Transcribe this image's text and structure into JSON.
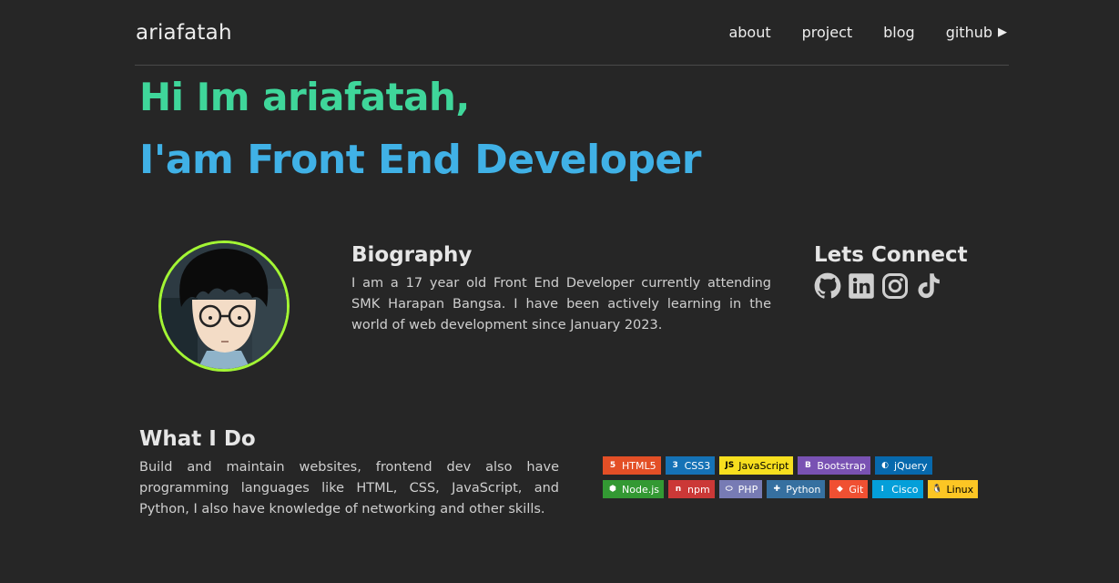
{
  "nav": {
    "brand": "ariafatah",
    "links": [
      "about",
      "project",
      "blog",
      "github"
    ],
    "github_arrow": "▶"
  },
  "hero": {
    "line1": "Hi Im ariafatah,",
    "line2": "I'am Front End Developer",
    "line1_color": "#3fd69a",
    "line2_color": "#40b1e6"
  },
  "biography": {
    "title": "Biography",
    "text": "I am a 17 year old Front End Developer currently attending SMK Harapan Bangsa. I have been actively learning in the world of web development since January 2023."
  },
  "connect": {
    "title": "Lets Connect",
    "icons": [
      "github-icon",
      "linkedin-icon",
      "instagram-icon",
      "tiktok-icon"
    ]
  },
  "what_i_do": {
    "title": "What I Do",
    "text": "Build and maintain websites, frontend dev also have programming languages like HTML, CSS, JavaScript, and Python, I also have knowledge of networking and other skills."
  },
  "badges": [
    {
      "label": "HTML5",
      "color": "#e34f26",
      "text_color": "#ffffff"
    },
    {
      "label": "CSS3",
      "color": "#1572b6",
      "text_color": "#ffffff"
    },
    {
      "label": "JavaScript",
      "color": "#f7df1e",
      "text_color": "#000000"
    },
    {
      "label": "Bootstrap",
      "color": "#7952b3",
      "text_color": "#ffffff"
    },
    {
      "label": "jQuery",
      "color": "#0769ad",
      "text_color": "#ffffff"
    },
    {
      "label": "Node.js",
      "color": "#339933",
      "text_color": "#ffffff"
    },
    {
      "label": "npm",
      "color": "#cb3837",
      "text_color": "#ffffff"
    },
    {
      "label": "PHP",
      "color": "#777bb4",
      "text_color": "#ffffff"
    },
    {
      "label": "Python",
      "color": "#3670a0",
      "text_color": "#ffffff"
    },
    {
      "label": "Git",
      "color": "#f05032",
      "text_color": "#ffffff"
    },
    {
      "label": "Cisco",
      "color": "#049fd9",
      "text_color": "#ffffff"
    },
    {
      "label": "Linux",
      "color": "#fcc624",
      "text_color": "#000000"
    }
  ],
  "colors": {
    "background": "#262626",
    "avatar_ring": "#a3f534"
  }
}
